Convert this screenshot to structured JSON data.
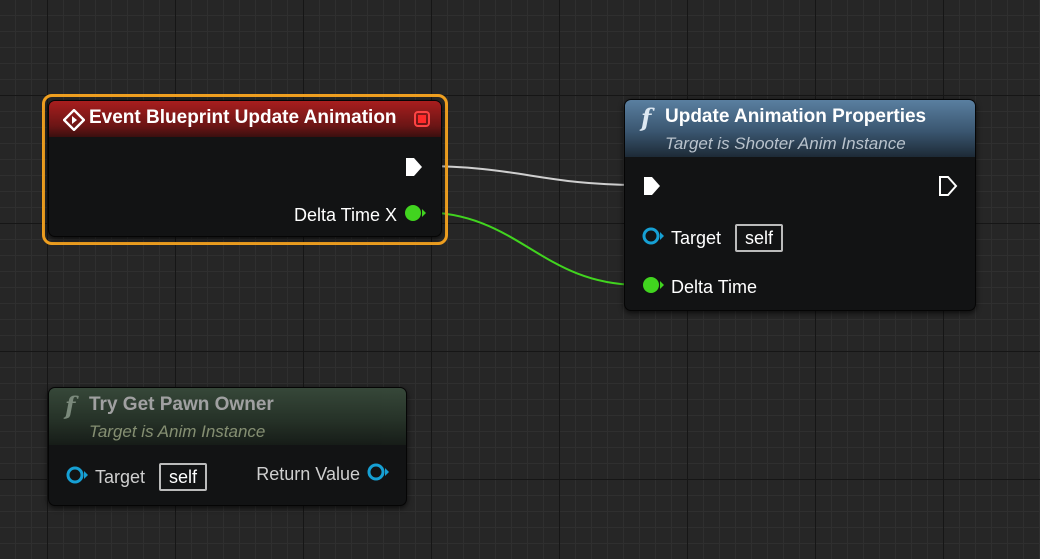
{
  "nodes": {
    "event_update": {
      "title": "Event Blueprint Update Animation",
      "delta_pin_label": "Delta Time X"
    },
    "update_props": {
      "title": "Update Animation Properties",
      "subtitle": "Target is Shooter Anim Instance",
      "target_label": "Target",
      "target_value": "self",
      "delta_label": "Delta Time"
    },
    "try_get_pawn": {
      "title": "Try Get Pawn Owner",
      "subtitle": "Target is Anim Instance",
      "target_label": "Target",
      "target_value": "self",
      "return_label": "Return Value"
    }
  },
  "icons": {
    "function": "f",
    "event": "event-diamond-icon"
  },
  "colors": {
    "event_header": "#8c1a1a",
    "function_header": "#3c5a74",
    "selection_outline": "#f0a020",
    "exec_wire": "#d8d8d8",
    "float_pin": "#41d41f",
    "object_pin": "#16a0d4"
  }
}
